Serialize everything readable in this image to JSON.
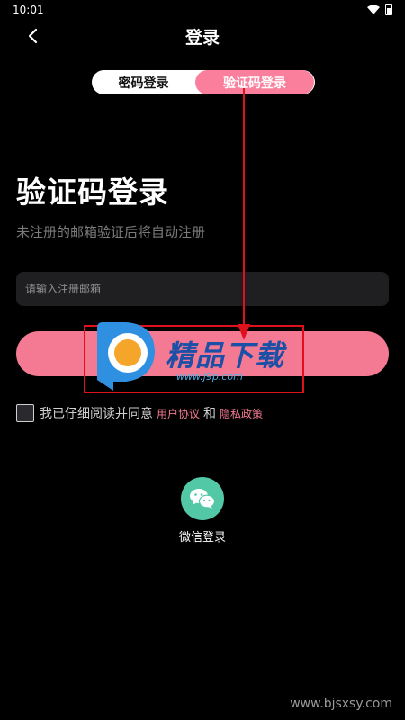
{
  "status_bar": {
    "time": "10:01"
  },
  "nav": {
    "title": "登录"
  },
  "tabs": [
    {
      "label": "密码登录",
      "active": false
    },
    {
      "label": "验证码登录",
      "active": true
    }
  ],
  "page": {
    "title": "验证码登录",
    "subtitle": "未注册的邮箱验证后将自动注册"
  },
  "email": {
    "placeholder": "请输入注册邮箱",
    "value": ""
  },
  "agreement": {
    "text": "我已仔细阅读并同意",
    "user_agreement": "用户协议",
    "and": "和",
    "privacy_policy": "隐私政策",
    "checked": false
  },
  "social": {
    "wechat_label": "微信登录"
  },
  "overlay": {
    "watermark_text": "精品下载",
    "watermark_url": "www.j9p.com",
    "site_watermark": "www.bjsxsy.com"
  },
  "colors": {
    "accent": "#f47a93",
    "background": "#000000",
    "wechat": "#52c8a7",
    "annotation": "#e0101c"
  }
}
